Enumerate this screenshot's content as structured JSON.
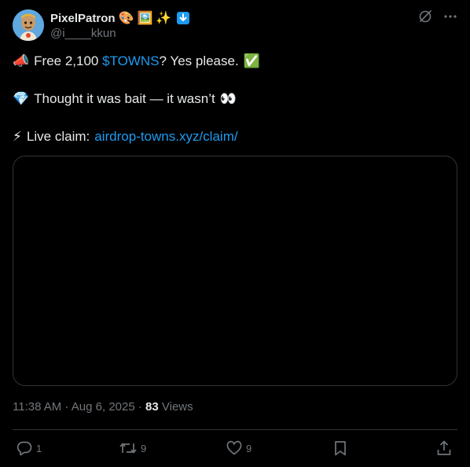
{
  "author": {
    "display_name": "PixelPatron",
    "name_emojis": [
      "🎨",
      "🖼️",
      "✨"
    ],
    "handle": "@i____kkun"
  },
  "tweet": {
    "lines": [
      {
        "emoji": "📣",
        "pre": "Free 2,100 ",
        "link": "$TOWNS",
        "post": "? Yes please.",
        "end_emoji": "✅"
      },
      {
        "emoji": "💎",
        "text": "Thought it was bait — it wasn’t",
        "end_emoji": "👀"
      },
      {
        "emoji": "⚡",
        "text": "Live claim:",
        "link": "airdrop-towns.xyz/claim/"
      }
    ]
  },
  "meta": {
    "time": "11:38 AM",
    "separator": " · ",
    "date": "Aug 6, 2025",
    "views_count": "83",
    "views_label": " Views"
  },
  "actions": {
    "replies": "1",
    "reposts": "9",
    "likes": "9"
  },
  "icons": {
    "top": [
      "grok-icon",
      "more-options-icon"
    ],
    "bar": [
      "reply-icon",
      "repost-icon",
      "like-icon",
      "bookmark-icon",
      "share-icon"
    ]
  },
  "colors": {
    "background": "#000000",
    "text": "#e7e9ea",
    "muted": "#71767b",
    "link": "#1d9bf0",
    "border": "#2f3336",
    "avatar_bg": "#5fa8e0",
    "badge": "#1d9bf0"
  }
}
